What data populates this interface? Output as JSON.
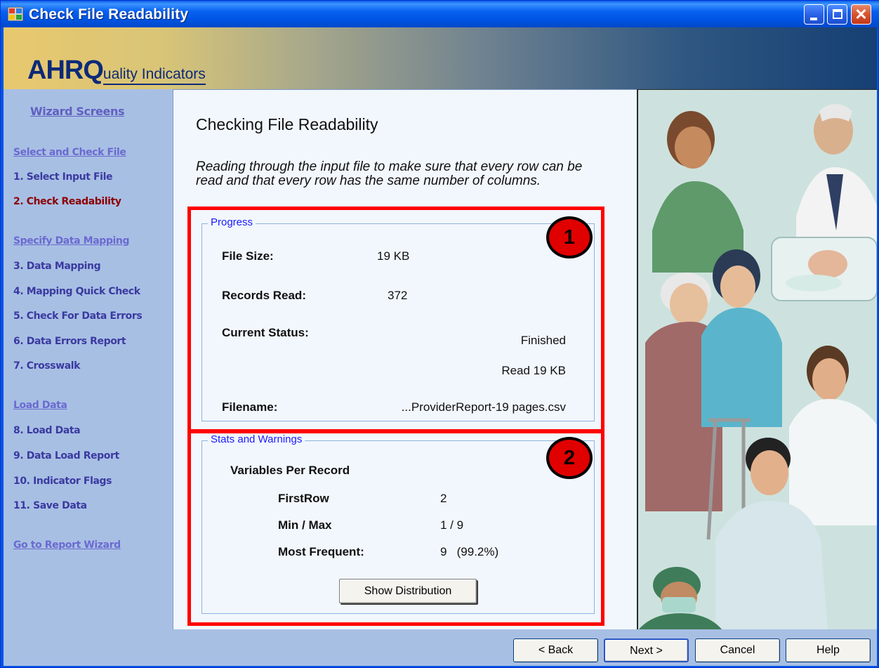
{
  "window": {
    "title": "Check File Readability"
  },
  "banner": {
    "logo_big": "AHRQ",
    "logo_small": "uality Indicators"
  },
  "sidebar": {
    "heading": "Wizard Screens",
    "items": [
      {
        "label": "Select and Check File",
        "kind": "section"
      },
      {
        "label": "1. Select Input File",
        "kind": "step"
      },
      {
        "label": "2. Check Readability",
        "kind": "active"
      },
      {
        "label": "Specify Data Mapping",
        "kind": "section"
      },
      {
        "label": "3. Data Mapping",
        "kind": "step"
      },
      {
        "label": "4. Mapping Quick Check",
        "kind": "step"
      },
      {
        "label": "5. Check For Data Errors",
        "kind": "step"
      },
      {
        "label": "6. Data Errors Report",
        "kind": "step"
      },
      {
        "label": "7. Crosswalk",
        "kind": "step"
      },
      {
        "label": "Load Data",
        "kind": "section"
      },
      {
        "label": "8. Load Data",
        "kind": "step"
      },
      {
        "label": "9. Data Load Report",
        "kind": "step"
      },
      {
        "label": "10. Indicator Flags",
        "kind": "step"
      },
      {
        "label": "11. Save Data",
        "kind": "step"
      },
      {
        "label": "Go to Report Wizard",
        "kind": "section"
      }
    ]
  },
  "main": {
    "title": "Checking File Readability",
    "description": "Reading through the input file to make sure that every row can be read and that every row has the same number of columns.",
    "progress": {
      "label": "Progress",
      "file_size_label": "File Size:",
      "file_size_value": "19 KB",
      "records_read_label": "Records Read:",
      "records_read_value": "372",
      "current_status_label": "Current Status:",
      "status_line1": "Finished",
      "status_line2": "Read 19 KB",
      "filename_label": "Filename:",
      "filename_value": "...ProviderReport-19 pages.csv"
    },
    "stats": {
      "label": "Stats and Warnings",
      "section_title": "Variables Per Record",
      "first_row_label": "FirstRow",
      "first_row_value": "2",
      "minmax_label": "Min / Max",
      "minmax_value": "1 / 9",
      "most_frequent_label": "Most Frequent:",
      "most_frequent_value": "9   (99.2%)",
      "show_distribution_label": "Show Distribution"
    },
    "annotations": {
      "badge1": "1",
      "badge2": "2",
      "highlight_color": "#ff0000"
    }
  },
  "footer": {
    "back_label": "< Back",
    "next_label": "Next >",
    "cancel_label": "Cancel",
    "help_label": "Help"
  },
  "colors": {
    "titlebar": "#0054e3",
    "sidebar_bg": "#a8bfe4",
    "sidebar_text": "#3a3aa0",
    "active_step": "#8b0000",
    "content_bg": "#f2f7fd",
    "group_label": "#1a1aff"
  }
}
